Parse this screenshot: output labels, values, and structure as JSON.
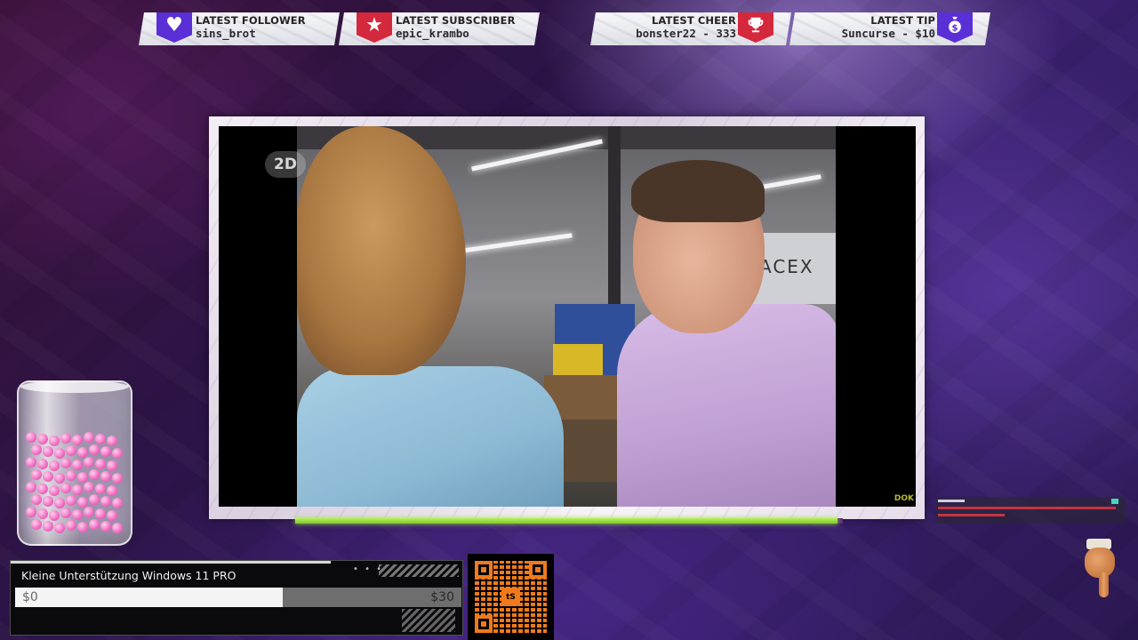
{
  "alerts": {
    "follower": {
      "title": "LATEST FOLLOWER",
      "value": "sins_brot",
      "icon": "heart-icon"
    },
    "subscriber": {
      "title": "LATEST SUBSCRIBER",
      "value": "epic_krambo",
      "icon": "star-icon"
    },
    "cheer": {
      "title": "LATEST CHEER",
      "value": "bonster22 - 333",
      "icon": "trophy-icon"
    },
    "tip": {
      "title": "LATEST TIP",
      "value": "Suncurse - $10",
      "icon": "money-bag-icon"
    }
  },
  "video": {
    "channel_logo": "2D",
    "corner_logo": "DOK",
    "sign_text": "ACEX",
    "progress": 0.99
  },
  "goal": {
    "title": "Kleine Unterstützung Windows 11 PRO",
    "start": "$0",
    "target": "$30",
    "progress": 0.6
  },
  "qr": {
    "center_label": "tS"
  },
  "colors": {
    "accent_purple": "#5b2fd6",
    "accent_red": "#d4283c",
    "progress_green": "#7ec92b",
    "qr_orange": "#f07a1b"
  }
}
